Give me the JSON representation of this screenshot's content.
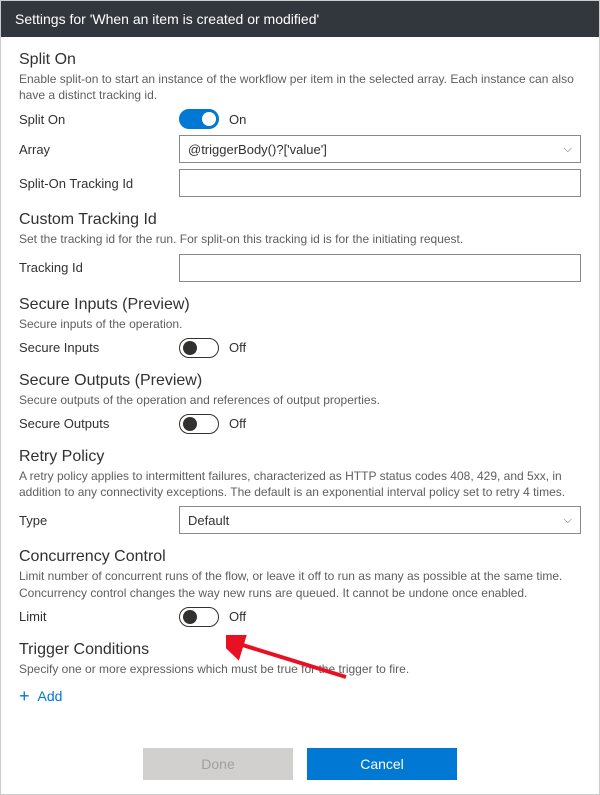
{
  "header": {
    "title": "Settings for 'When an item is created or modified'"
  },
  "splitOn": {
    "title": "Split On",
    "desc": "Enable split-on to start an instance of the workflow per item in the selected array. Each instance can also have a distinct tracking id.",
    "toggleLabel": "Split On",
    "toggleState": "On",
    "arrayLabel": "Array",
    "arrayValue": "@triggerBody()?['value']",
    "trackingLabel": "Split-On Tracking Id",
    "trackingValue": ""
  },
  "customTracking": {
    "title": "Custom Tracking Id",
    "desc": "Set the tracking id for the run. For split-on this tracking id is for the initiating request.",
    "label": "Tracking Id",
    "value": ""
  },
  "secureInputs": {
    "title": "Secure Inputs (Preview)",
    "desc": "Secure inputs of the operation.",
    "label": "Secure Inputs",
    "state": "Off"
  },
  "secureOutputs": {
    "title": "Secure Outputs (Preview)",
    "desc": "Secure outputs of the operation and references of output properties.",
    "label": "Secure Outputs",
    "state": "Off"
  },
  "retry": {
    "title": "Retry Policy",
    "desc": "A retry policy applies to intermittent failures, characterized as HTTP status codes 408, 429, and 5xx, in addition to any connectivity exceptions. The default is an exponential interval policy set to retry 4 times.",
    "typeLabel": "Type",
    "typeValue": "Default"
  },
  "concurrency": {
    "title": "Concurrency Control",
    "desc": "Limit number of concurrent runs of the flow, or leave it off to run as many as possible at the same time. Concurrency control changes the way new runs are queued. It cannot be undone once enabled.",
    "label": "Limit",
    "state": "Off"
  },
  "triggerConditions": {
    "title": "Trigger Conditions",
    "desc": "Specify one or more expressions which must be true for the trigger to fire.",
    "addLabel": "Add"
  },
  "footer": {
    "done": "Done",
    "cancel": "Cancel"
  }
}
